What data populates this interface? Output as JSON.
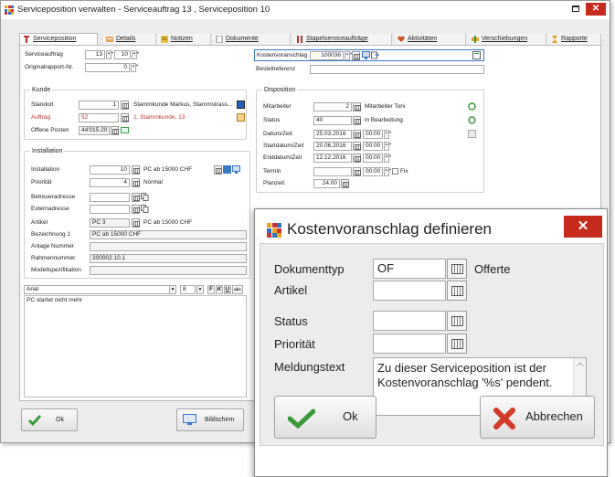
{
  "window": {
    "title": "Serviceposition verwalten - Serviceauftrag 13 , Serviceposition 10",
    "close_glyph": "✕"
  },
  "tabs": [
    {
      "label": "Serviceposition",
      "icon": "service-icon",
      "active": true
    },
    {
      "label": "Details",
      "icon": "details-icon"
    },
    {
      "label": "Notizen",
      "icon": "notes-icon"
    },
    {
      "label": "Dokumente",
      "icon": "document-icon"
    },
    {
      "label": "Stapelserviceaufträge",
      "icon": "stack-icon"
    },
    {
      "label": "Aktivitäten",
      "icon": "heart-icon"
    },
    {
      "label": "Verschiebungen",
      "icon": "move-icon"
    },
    {
      "label": "Rapporte",
      "icon": "hourglass-icon"
    }
  ],
  "header_fields": {
    "serviceauftrag_label": "Serviceauftrag",
    "serviceauftrag_value": "13",
    "serviceposition_value": "10",
    "originalrapport_label": "Originalrapport-Nr.",
    "originalrapport_value": "0",
    "kostenvoranschlag_label": "Kostenvoranschlag",
    "kostenvoranschlag_value": "100036",
    "bestellreferenz_label": "Bestellreferenz",
    "bestellreferenz_value": ""
  },
  "kunde": {
    "title": "Kunde",
    "standort_label": "Standort",
    "standort_value": "1",
    "standort_text": "Stammkunde Markus, Stammstrass...",
    "auftrag_label": "Auftrag",
    "auftrag_value": "52",
    "auftrag_text": "1, Stammkunde, 13",
    "offene_posten_label": "Offene Posten",
    "offene_posten_value": "44'015.20"
  },
  "disposition": {
    "title": "Disposition",
    "mitarbeiter_label": "Mitarbeiter",
    "mitarbeiter_value": "2",
    "mitarbeiter_text": "Mitarbeiter Toni",
    "status_label": "Status",
    "status_value": "40",
    "status_text": "in Bearbeitung",
    "datum_label": "Datum/Zeit",
    "datum_value": "25.03.2016",
    "datum_time": "00:00",
    "start_label": "Startdatum/Zeit",
    "start_value": "20.06.2016",
    "start_time": "00:00",
    "end_label": "Enddatum/Zeit",
    "end_value": "12.12.2016",
    "end_time": "00:00",
    "termin_label": "Termin",
    "termin_time": "00:00",
    "fix_label": "Fix",
    "planzeit_label": "Planzeit",
    "planzeit_value": "24.00"
  },
  "installation": {
    "title": "Installation",
    "installation_label": "Installation",
    "installation_value": "10",
    "installation_text": "PC ab 15000 CHF",
    "prioritaet_label": "Priorität",
    "prioritaet_value": "4",
    "prioritaet_text": "Normal",
    "betreuer_label": "Betreueradresse",
    "extern_label": "Externadresse",
    "artikel_label": "Artikel",
    "artikel_value": "PC 3",
    "artikel_text": "PC ab 15000 CHF",
    "bez_label": "Bezeichnung 1",
    "bez_value": "PC ab 15000 CHF",
    "anlage_label": "Anlage Nummer",
    "anlage_value": "",
    "rahmen_label": "Rahmennummer",
    "rahmen_value": "300002.10.1",
    "modell_label": "Modellspezifikation",
    "modell_value": ""
  },
  "editor": {
    "font": "Arial",
    "size": "8",
    "bold": "F",
    "italic": "K",
    "underline": "U",
    "abc": "abc",
    "text": "PC startet nicht mehr"
  },
  "bottom": {
    "ok_label": "Ok",
    "bildschirm_label": "Bildschirm"
  },
  "dialog": {
    "title": "Kostenvoranschlag definieren",
    "close_glyph": "✕",
    "dokumenttyp_label": "Dokumenttyp",
    "dokumenttyp_value": "OF",
    "dokumenttyp_text": "Offerte",
    "artikel_label": "Artikel",
    "artikel_value": "",
    "status_label": "Status",
    "status_value": "",
    "prioritaet_label": "Priorität",
    "prioritaet_value": "",
    "meldungstext_label": "Meldungstext",
    "meldungstext_value": "Zu dieser Serviceposition ist der Kostenvoranschlag '%s' pendent.",
    "ok_label": "Ok",
    "cancel_label": "Abbrechen"
  },
  "colors": {
    "accent_green": "#3a9a3a",
    "cancel_red": "#d23a2a",
    "close_red": "#c42b1c",
    "highlight_blue": "#3a78c9"
  }
}
